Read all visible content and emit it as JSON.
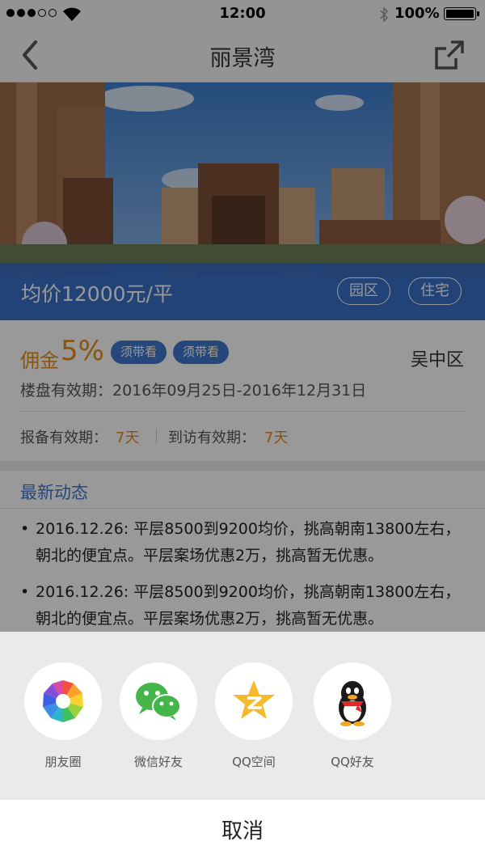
{
  "status_bar": {
    "time": "12:00",
    "battery": "100%",
    "signal_bars": 3,
    "signal_total": 5
  },
  "nav": {
    "title": "丽景湾",
    "back_icon": "chevron-left-icon",
    "share_icon": "share-external-icon"
  },
  "hero": {
    "price": "均价12000元/平",
    "tags": [
      "园区",
      "住宅"
    ],
    "band_color": "#346cc4"
  },
  "info": {
    "commission_label": "佣金",
    "commission_value": "5%",
    "badges": [
      "须带看",
      "须带看"
    ],
    "district": "吴中区",
    "validity": "楼盘有效期：2016年09月25日-2016年12月31日",
    "report_label": "报备有效期：",
    "report_value": "7天",
    "visit_label": "到访有效期：",
    "visit_value": "7天",
    "accent_color": "#e48a1c"
  },
  "news": {
    "title": "最新动态",
    "items": [
      "2016.12.26: 平层8500到9200均价，挑高朝南13800左右，朝北的便宜点。平层案场优惠2万，挑高暂无优惠。",
      "2016.12.26: 平层8500到9200均价，挑高朝南13800左右，朝北的便宜点。平层案场优惠2万，挑高暂无优惠。"
    ],
    "bullet": "•"
  },
  "share_sheet": {
    "targets": [
      {
        "label": "朋友圈",
        "icon": "moments-aperture-icon"
      },
      {
        "label": "微信好友",
        "icon": "wechat-icon"
      },
      {
        "label": "QQ空间",
        "icon": "qzone-star-icon"
      },
      {
        "label": "QQ好友",
        "icon": "qq-penguin-icon"
      }
    ],
    "cancel": "取消"
  }
}
